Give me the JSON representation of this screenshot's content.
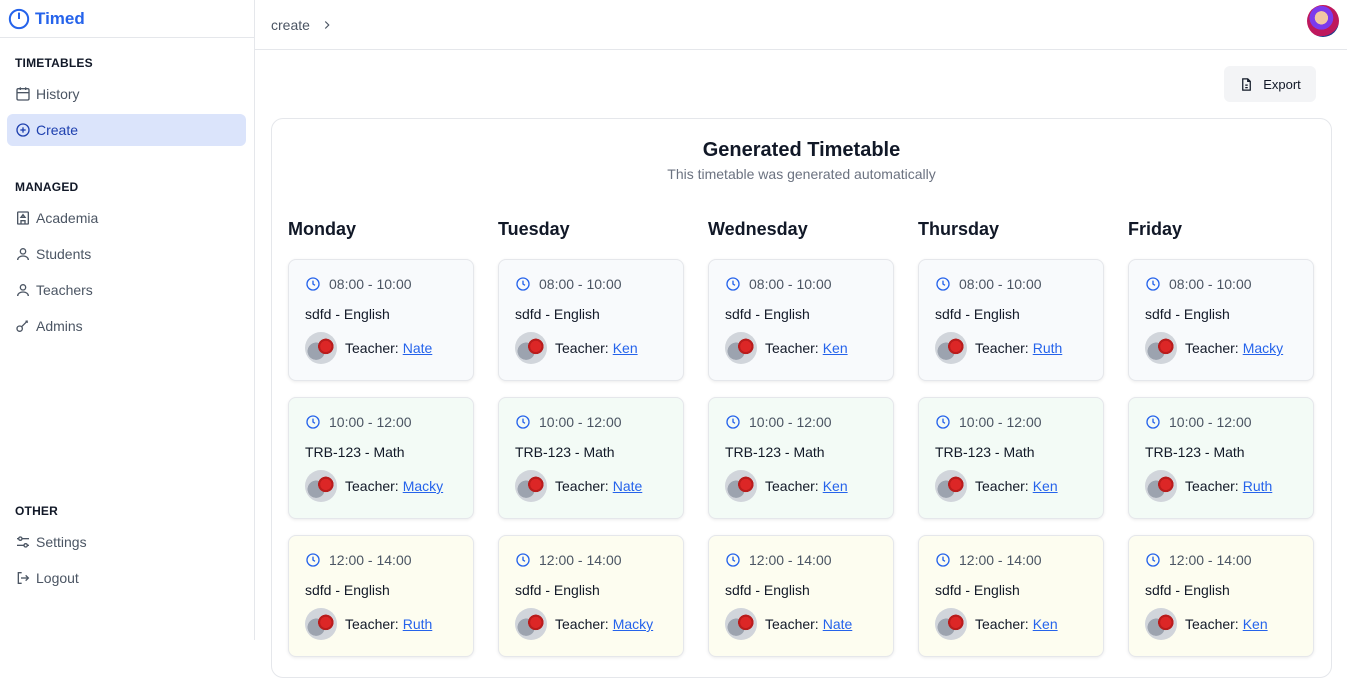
{
  "app": {
    "name": "Timed"
  },
  "sidebar": {
    "sections": [
      {
        "title": "TIMETABLES",
        "items": [
          {
            "label": "History",
            "icon": "calendar-icon",
            "active": false
          },
          {
            "label": "Create",
            "icon": "plus-circle-icon",
            "active": true
          }
        ]
      },
      {
        "title": "MANAGED",
        "items": [
          {
            "label": "Academia",
            "icon": "building-icon",
            "active": false
          },
          {
            "label": "Students",
            "icon": "user-icon",
            "active": false
          },
          {
            "label": "Teachers",
            "icon": "user-icon",
            "active": false
          },
          {
            "label": "Admins",
            "icon": "key-icon",
            "active": false
          }
        ]
      },
      {
        "title": "OTHER",
        "items": [
          {
            "label": "Settings",
            "icon": "sliders-icon",
            "active": false
          },
          {
            "label": "Logout",
            "icon": "logout-icon",
            "active": false
          }
        ]
      }
    ]
  },
  "topbar": {
    "breadcrumb": "create"
  },
  "export": {
    "label": "Export"
  },
  "timetable": {
    "title": "Generated Timetable",
    "subtitle": "This timetable was generated automatically",
    "teacher_prefix": "Teacher:",
    "slot_colors": [
      "#f8fafc",
      "#f3fbf6",
      "#fdfdf0"
    ],
    "days": [
      {
        "name": "Monday",
        "slots": [
          {
            "time": "08:00 - 10:00",
            "subject": "sdfd - English",
            "teacher": "Nate"
          },
          {
            "time": "10:00 - 12:00",
            "subject": "TRB-123 - Math",
            "teacher": "Macky"
          },
          {
            "time": "12:00 - 14:00",
            "subject": "sdfd - English",
            "teacher": "Ruth"
          }
        ]
      },
      {
        "name": "Tuesday",
        "slots": [
          {
            "time": "08:00 - 10:00",
            "subject": "sdfd - English",
            "teacher": "Ken"
          },
          {
            "time": "10:00 - 12:00",
            "subject": "TRB-123 - Math",
            "teacher": "Nate"
          },
          {
            "time": "12:00 - 14:00",
            "subject": "sdfd - English",
            "teacher": "Macky"
          }
        ]
      },
      {
        "name": "Wednesday",
        "slots": [
          {
            "time": "08:00 - 10:00",
            "subject": "sdfd - English",
            "teacher": "Ken"
          },
          {
            "time": "10:00 - 12:00",
            "subject": "TRB-123 - Math",
            "teacher": "Ken"
          },
          {
            "time": "12:00 - 14:00",
            "subject": "sdfd - English",
            "teacher": "Nate"
          }
        ]
      },
      {
        "name": "Thursday",
        "slots": [
          {
            "time": "08:00 - 10:00",
            "subject": "sdfd - English",
            "teacher": "Ruth"
          },
          {
            "time": "10:00 - 12:00",
            "subject": "TRB-123 - Math",
            "teacher": "Ken"
          },
          {
            "time": "12:00 - 14:00",
            "subject": "sdfd - English",
            "teacher": "Ken"
          }
        ]
      },
      {
        "name": "Friday",
        "slots": [
          {
            "time": "08:00 - 10:00",
            "subject": "sdfd - English",
            "teacher": "Macky"
          },
          {
            "time": "10:00 - 12:00",
            "subject": "TRB-123 - Math",
            "teacher": "Ruth"
          },
          {
            "time": "12:00 - 14:00",
            "subject": "sdfd - English",
            "teacher": "Ken"
          }
        ]
      }
    ]
  }
}
